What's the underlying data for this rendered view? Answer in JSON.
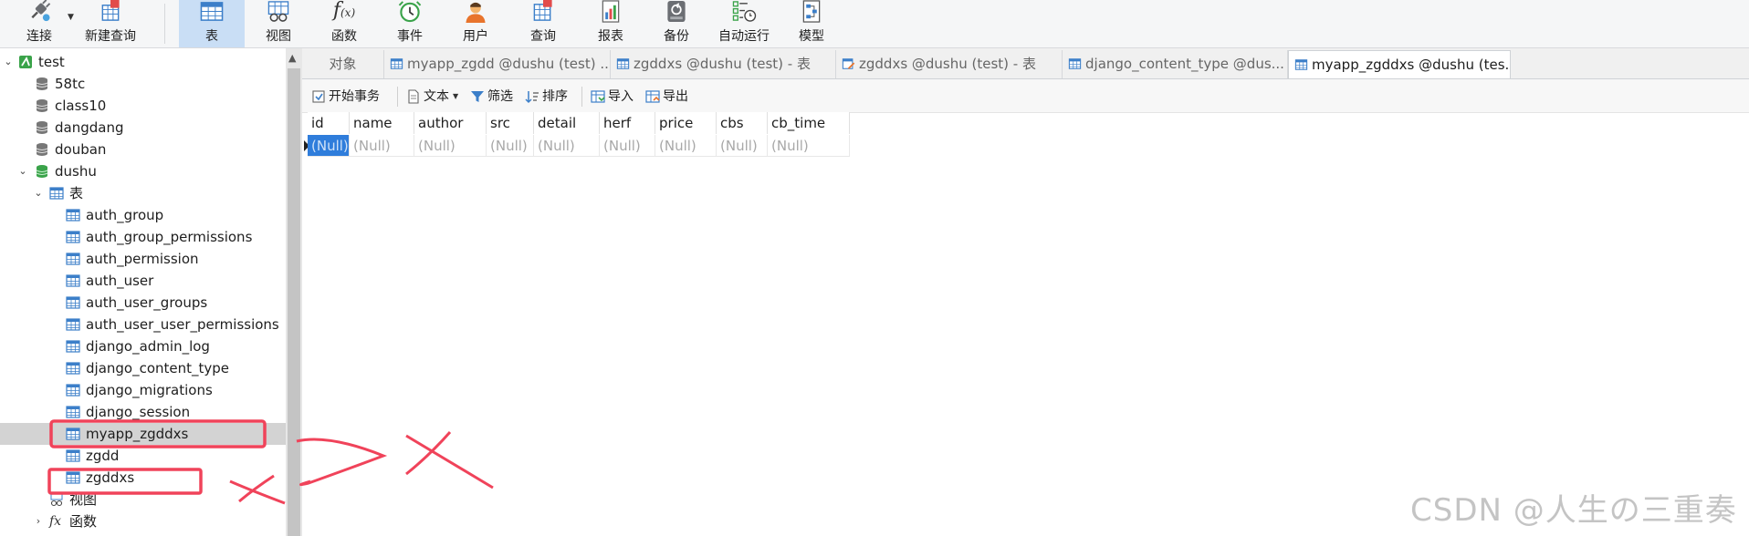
{
  "toolbar": {
    "buttons": [
      {
        "label": "连接",
        "icon": "plug-icon"
      },
      {
        "label": "新建查询",
        "icon": "new-query-icon"
      },
      {
        "label": "表",
        "icon": "table-icon"
      },
      {
        "label": "视图",
        "icon": "view-icon"
      },
      {
        "label": "函数",
        "icon": "function-icon"
      },
      {
        "label": "事件",
        "icon": "clock-icon"
      },
      {
        "label": "用户",
        "icon": "user-icon"
      },
      {
        "label": "查询",
        "icon": "query-icon"
      },
      {
        "label": "报表",
        "icon": "report-icon"
      },
      {
        "label": "备份",
        "icon": "backup-icon"
      },
      {
        "label": "自动运行",
        "icon": "schedule-icon"
      },
      {
        "label": "模型",
        "icon": "model-icon"
      }
    ],
    "active": "表"
  },
  "navigator": {
    "items": [
      {
        "label": "test",
        "type": "connection"
      },
      {
        "label": "58tc",
        "type": "database"
      },
      {
        "label": "class10",
        "type": "database"
      },
      {
        "label": "dangdang",
        "type": "database"
      },
      {
        "label": "douban",
        "type": "database"
      },
      {
        "label": "dushu",
        "type": "database-open"
      },
      {
        "label": "表",
        "type": "folder"
      },
      {
        "label": "auth_group",
        "type": "table"
      },
      {
        "label": "auth_group_permissions",
        "type": "table"
      },
      {
        "label": "auth_permission",
        "type": "table"
      },
      {
        "label": "auth_user",
        "type": "table"
      },
      {
        "label": "auth_user_groups",
        "type": "table"
      },
      {
        "label": "auth_user_user_permissions",
        "type": "table"
      },
      {
        "label": "django_admin_log",
        "type": "table"
      },
      {
        "label": "django_content_type",
        "type": "table"
      },
      {
        "label": "django_migrations",
        "type": "table"
      },
      {
        "label": "django_session",
        "type": "table"
      },
      {
        "label": "myapp_zgddxs",
        "type": "table",
        "selected": true
      },
      {
        "label": "zgdd",
        "type": "table"
      },
      {
        "label": "zgddxs",
        "type": "table"
      },
      {
        "label": "视图",
        "type": "views"
      },
      {
        "label": "函数",
        "type": "functions"
      }
    ]
  },
  "tabs": [
    {
      "label": "对象",
      "icon": ""
    },
    {
      "label": "myapp_zgdd @dushu (test) ...",
      "icon": "table-icon"
    },
    {
      "label": "zgddxs @dushu (test) - 表",
      "icon": "table-icon"
    },
    {
      "label": "zgddxs @dushu (test) - 表",
      "icon": "table-design-icon"
    },
    {
      "label": "django_content_type @dus...",
      "icon": "table-icon"
    },
    {
      "label": "myapp_zgddxs @dushu (tes...",
      "icon": "table-icon",
      "active": true
    }
  ],
  "subtoolbar": {
    "begin_transaction": "开始事务",
    "text": "文本",
    "filter": "筛选",
    "sort": "排序",
    "import": "导入",
    "export": "导出"
  },
  "grid": {
    "columns": [
      "id",
      "name",
      "author",
      "src",
      "detail",
      "herf",
      "price",
      "cbs",
      "cb_time"
    ],
    "rows": [
      [
        "(Null)",
        "(Null)",
        "(Null)",
        "(Null)",
        "(Null)",
        "(Null)",
        "(Null)",
        "(Null)",
        "(Null)"
      ]
    ]
  },
  "watermark": "CSDN @人生の三重奏",
  "colors": {
    "accent": "#2f7ddb",
    "annotation": "#f0435a",
    "active_tab": "#c9def5"
  }
}
